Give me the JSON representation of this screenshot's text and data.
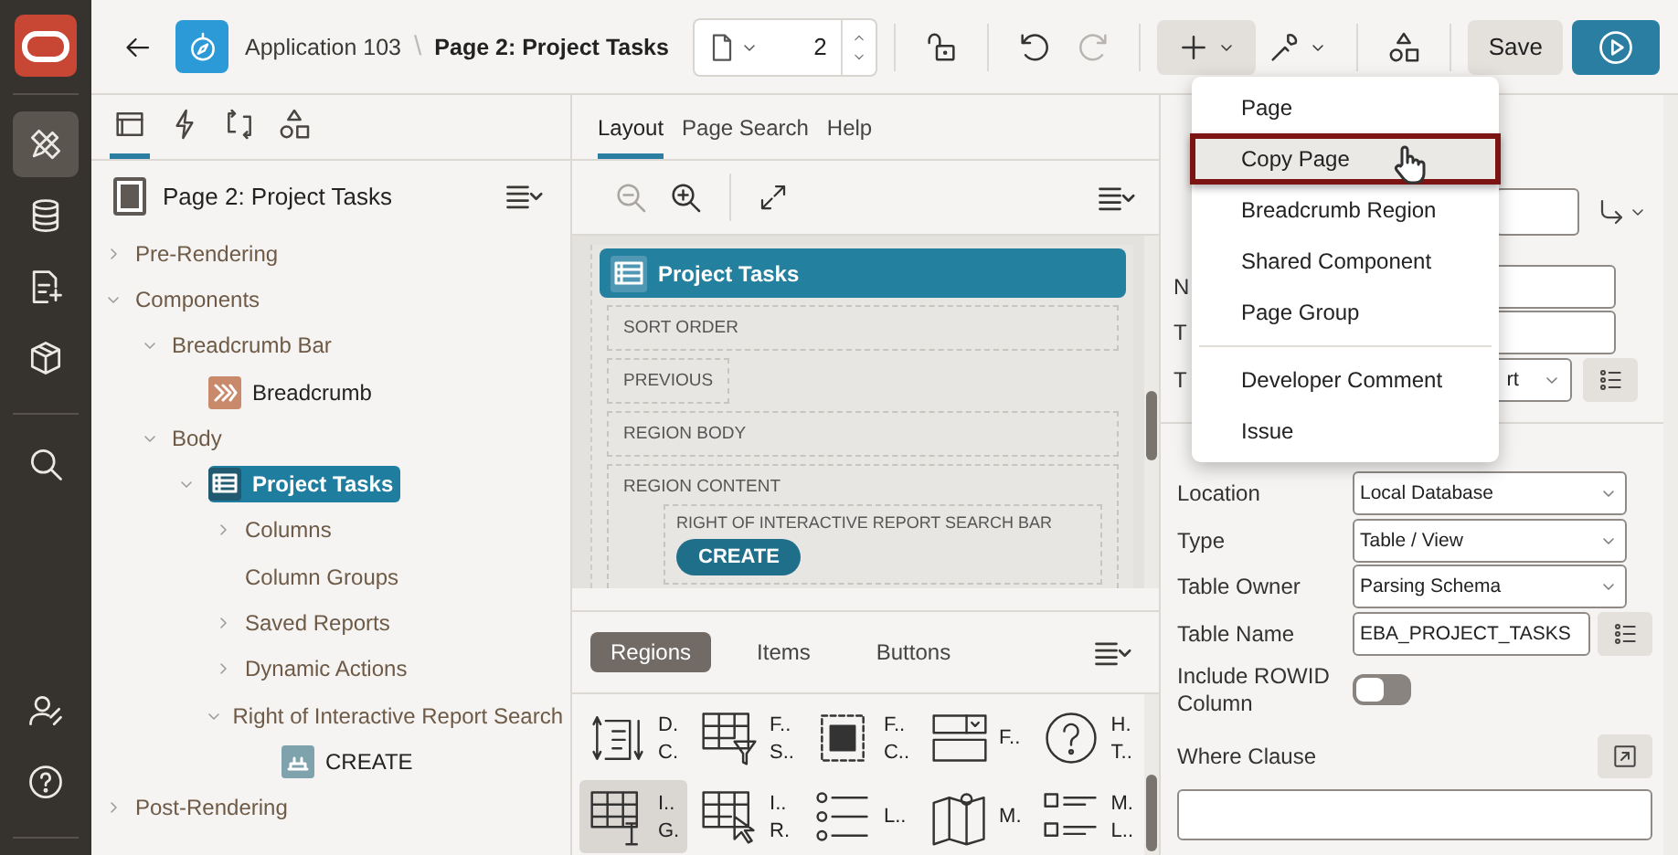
{
  "rail": [
    {
      "kind": "logo"
    },
    {
      "kind": "tools",
      "selected": true
    },
    {
      "kind": "database",
      "selected": false
    },
    {
      "kind": "document",
      "selected": false
    },
    {
      "kind": "package",
      "selected": false
    },
    {
      "kind": "search",
      "selected": false
    },
    {
      "kind": "user",
      "selected": false
    },
    {
      "kind": "help",
      "selected": false
    }
  ],
  "topbar": {
    "app": "Application 103",
    "separator": "\\",
    "page": "Page 2: Project Tasks",
    "page_number": "2",
    "save": "Save",
    "tools": [
      {
        "kind": "lock",
        "disabled": false
      },
      {
        "kind": "undo",
        "disabled": false
      },
      {
        "kind": "redo",
        "disabled": true
      },
      {
        "kind": "create",
        "active": true
      },
      {
        "kind": "utilities",
        "active": false
      },
      {
        "kind": "shared"
      }
    ]
  },
  "left_panel": {
    "tabs": [
      {
        "kind": "layout",
        "selected": true
      },
      {
        "kind": "dynamic",
        "selected": false
      },
      {
        "kind": "processing",
        "selected": false
      },
      {
        "kind": "shared",
        "selected": false
      }
    ],
    "title": "Page 2: Project Tasks",
    "tree": [
      {
        "label": "Pre-Rendering",
        "expanded": false,
        "selected": false
      },
      {
        "label": "Components",
        "expanded": true,
        "selected": false,
        "children": [
          {
            "label": "Breadcrumb Bar",
            "expanded": true,
            "selected": false,
            "children": [
              {
                "label": "Breadcrumb",
                "kind": "breadcrumb",
                "selected": false
              }
            ]
          },
          {
            "label": "Body",
            "expanded": true,
            "selected": false,
            "children": [
              {
                "label": "Project Tasks",
                "kind": "report",
                "expanded": true,
                "selected": true,
                "children": [
                  {
                    "label": "Columns",
                    "expanded": false,
                    "selected": false
                  },
                  {
                    "label": "Column Groups",
                    "selected": false
                  },
                  {
                    "label": "Saved Reports",
                    "expanded": false,
                    "selected": false
                  },
                  {
                    "label": "Dynamic Actions",
                    "expanded": false,
                    "selected": false
                  },
                  {
                    "label": "Right of Interactive Report Search",
                    "expanded": true,
                    "selected": false,
                    "children": [
                      {
                        "label": "CREATE",
                        "kind": "button",
                        "selected": false
                      }
                    ]
                  }
                ]
              }
            ]
          }
        ]
      },
      {
        "label": "Post-Rendering",
        "expanded": false,
        "selected": false
      }
    ]
  },
  "middle_panel": {
    "tabs": [
      {
        "label": "Layout",
        "selected": true
      },
      {
        "label": "Page Search",
        "selected": false
      },
      {
        "label": "Help",
        "selected": false
      }
    ],
    "canvas": {
      "region_title": "Project Tasks",
      "slots": [
        {
          "label": "SORT ORDER",
          "kind": "full"
        },
        {
          "label": "PREVIOUS",
          "kind": "narrow"
        },
        {
          "label": "REGION BODY",
          "kind": "full"
        },
        {
          "label": "REGION CONTENT",
          "kind": "full",
          "inner": {
            "label": "RIGHT OF INTERACTIVE REPORT SEARCH BAR",
            "button": "CREATE"
          }
        }
      ]
    },
    "gallery_tabs": [
      {
        "label": "Regions",
        "selected": true
      },
      {
        "label": "Items",
        "selected": false
      },
      {
        "label": "Buttons",
        "selected": false
      }
    ],
    "gallery": [
      {
        "kind": "dynamic",
        "lines": [
          "D.",
          "C."
        ],
        "selected": false
      },
      {
        "kind": "filter",
        "lines": [
          "F..",
          "S.."
        ],
        "selected": false
      },
      {
        "kind": "frame",
        "lines": [
          "F..",
          "C.."
        ],
        "selected": false
      },
      {
        "kind": "form",
        "lines": [
          "F.."
        ],
        "selected": false
      },
      {
        "kind": "help",
        "lines": [
          "H.",
          "T.."
        ],
        "selected": false
      },
      {
        "kind": "grid",
        "lines": [
          "I..",
          "G."
        ],
        "selected": true
      },
      {
        "kind": "report",
        "lines": [
          "I..",
          "R."
        ],
        "selected": false
      },
      {
        "kind": "list",
        "lines": [
          "L.."
        ],
        "selected": false
      },
      {
        "kind": "map",
        "lines": [
          "M."
        ],
        "selected": false
      },
      {
        "kind": "checklist",
        "lines": [
          "M.",
          "L.."
        ],
        "selected": false
      }
    ]
  },
  "right_panel": {
    "covered_rows": [
      {
        "label": "N",
        "kind": "text"
      },
      {
        "label": "T",
        "kind": "text"
      },
      {
        "label": "T",
        "kind": "select",
        "value": "rt"
      }
    ],
    "rows": [
      {
        "label": "Location",
        "kind": "select",
        "value": "Local Database"
      },
      {
        "label": "Type",
        "kind": "select",
        "value": "Table / View"
      },
      {
        "label": "Table Owner",
        "kind": "select",
        "value": "Parsing Schema"
      },
      {
        "label": "Table Name",
        "kind": "lov",
        "value": "EBA_PROJECT_TASKS"
      },
      {
        "label": "Include ROWID Column",
        "kind": "toggle",
        "on": false
      }
    ],
    "where_clause": "Where Clause"
  },
  "menu": {
    "items": [
      {
        "label": "Page",
        "selected": false,
        "divider_before": false
      },
      {
        "label": "Copy Page",
        "selected": true,
        "divider_before": false
      },
      {
        "label": "Breadcrumb Region",
        "selected": false,
        "divider_before": false
      },
      {
        "label": "Shared Component",
        "selected": false,
        "divider_before": false
      },
      {
        "label": "Page Group",
        "selected": false,
        "divider_before": false
      },
      {
        "label": "Developer Comment",
        "selected": false,
        "divider_before": true
      },
      {
        "label": "Issue",
        "selected": false,
        "divider_before": false
      }
    ]
  }
}
